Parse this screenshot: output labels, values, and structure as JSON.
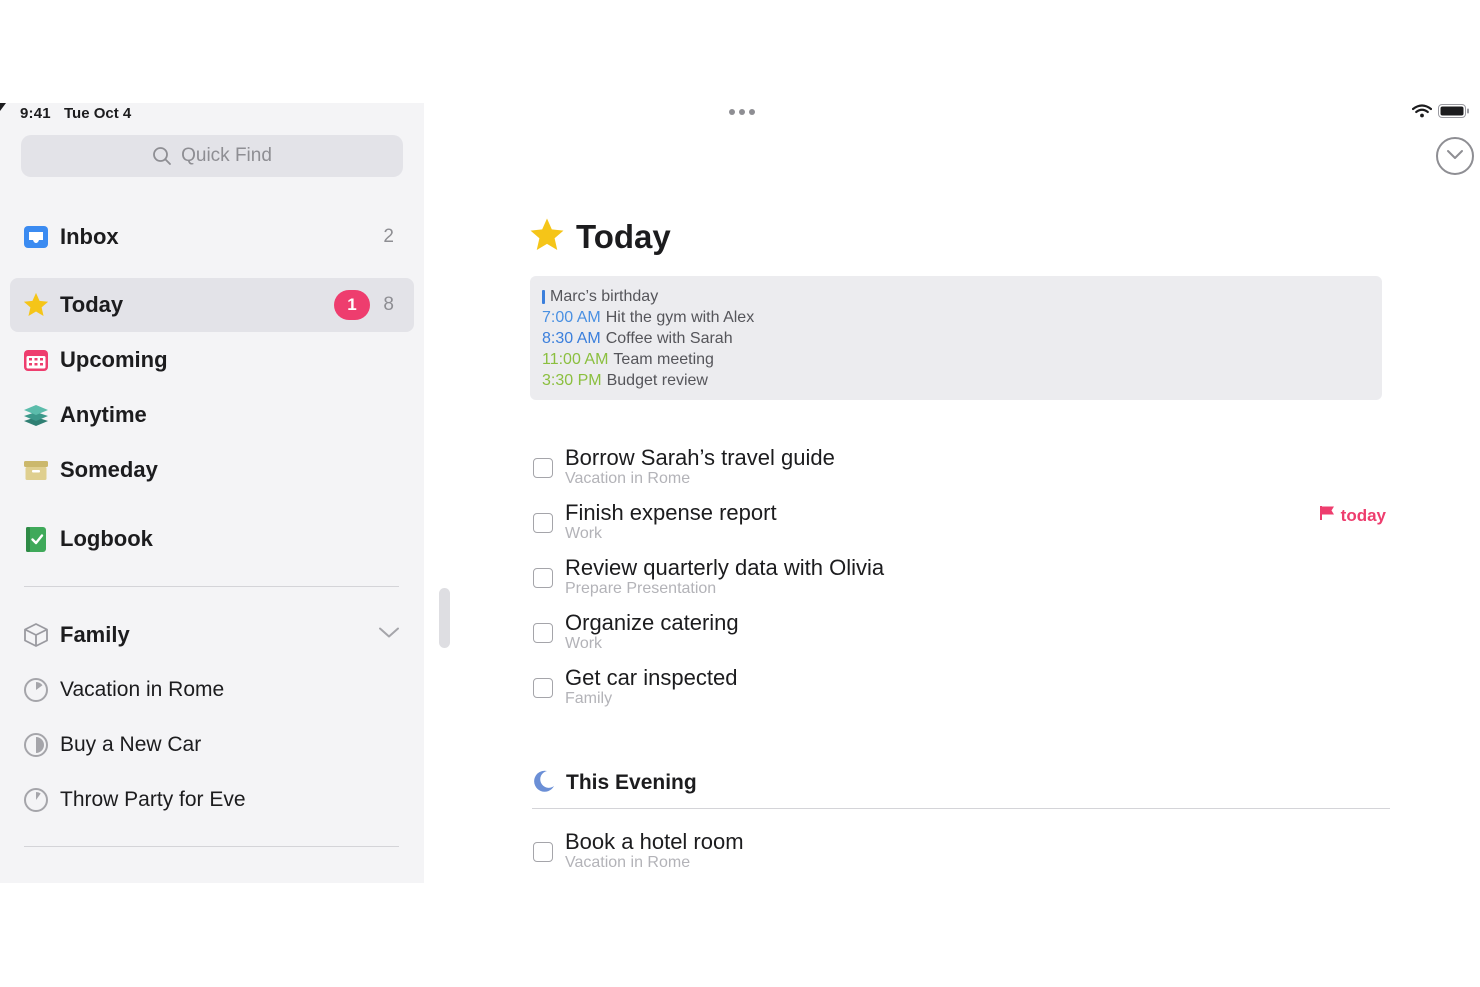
{
  "status": {
    "time": "9:41",
    "date": "Tue Oct 4"
  },
  "sidebar": {
    "search_placeholder": "Quick Find",
    "lists": [
      {
        "label": "Inbox",
        "count": "2",
        "icon": "inbox-icon",
        "color": "#3b8bf1"
      },
      {
        "label": "Today",
        "badge": "1",
        "count": "8",
        "icon": "star-icon",
        "color": "#f5c518",
        "selected": true
      },
      {
        "label": "Upcoming",
        "icon": "calendar-icon",
        "color": "#ee3d6e"
      },
      {
        "label": "Anytime",
        "icon": "layers-icon",
        "color": "#4ba89b"
      },
      {
        "label": "Someday",
        "icon": "archive-box-icon",
        "color": "#d4c27b"
      },
      {
        "label": "Logbook",
        "icon": "logbook-icon",
        "color": "#3fa95a"
      }
    ],
    "area": {
      "label": "Family",
      "icon": "cube-icon"
    },
    "projects": [
      {
        "label": "Vacation in Rome",
        "progress": 0.15
      },
      {
        "label": "Buy a New Car",
        "progress": 0.5
      },
      {
        "label": "Throw Party for Eve",
        "progress": 0.1
      }
    ]
  },
  "main": {
    "title": "Today",
    "calendar": [
      {
        "time": "",
        "text": "Marc’s birthday",
        "color": "#3b7fdc",
        "all_day": true
      },
      {
        "time": "7:00 AM",
        "text": "Hit the gym with Alex",
        "color": "#4a90e2"
      },
      {
        "time": "8:30 AM",
        "text": "Coffee with Sarah",
        "color": "#3b7fdc"
      },
      {
        "time": "11:00 AM",
        "text": "Team meeting",
        "color": "#8bbf3f"
      },
      {
        "time": "3:30 PM",
        "text": "Budget review",
        "color": "#8bbf3f"
      }
    ],
    "todos": [
      {
        "title": "Borrow Sarah’s travel guide",
        "project": "Vacation in Rome"
      },
      {
        "title": "Finish expense report",
        "project": "Work",
        "deadline": "today"
      },
      {
        "title": "Review quarterly data with Olivia",
        "project": "Prepare Presentation"
      },
      {
        "title": "Organize catering",
        "project": "Work"
      },
      {
        "title": "Get car inspected",
        "project": "Family"
      }
    ],
    "evening": {
      "title": "This Evening",
      "todos": [
        {
          "title": "Book a hotel room",
          "project": "Vacation in Rome"
        }
      ]
    }
  },
  "colors": {
    "accent_pink": "#ee3d6e",
    "sidebar_bg": "#f4f4f6",
    "selected_bg": "#e3e3e8"
  }
}
